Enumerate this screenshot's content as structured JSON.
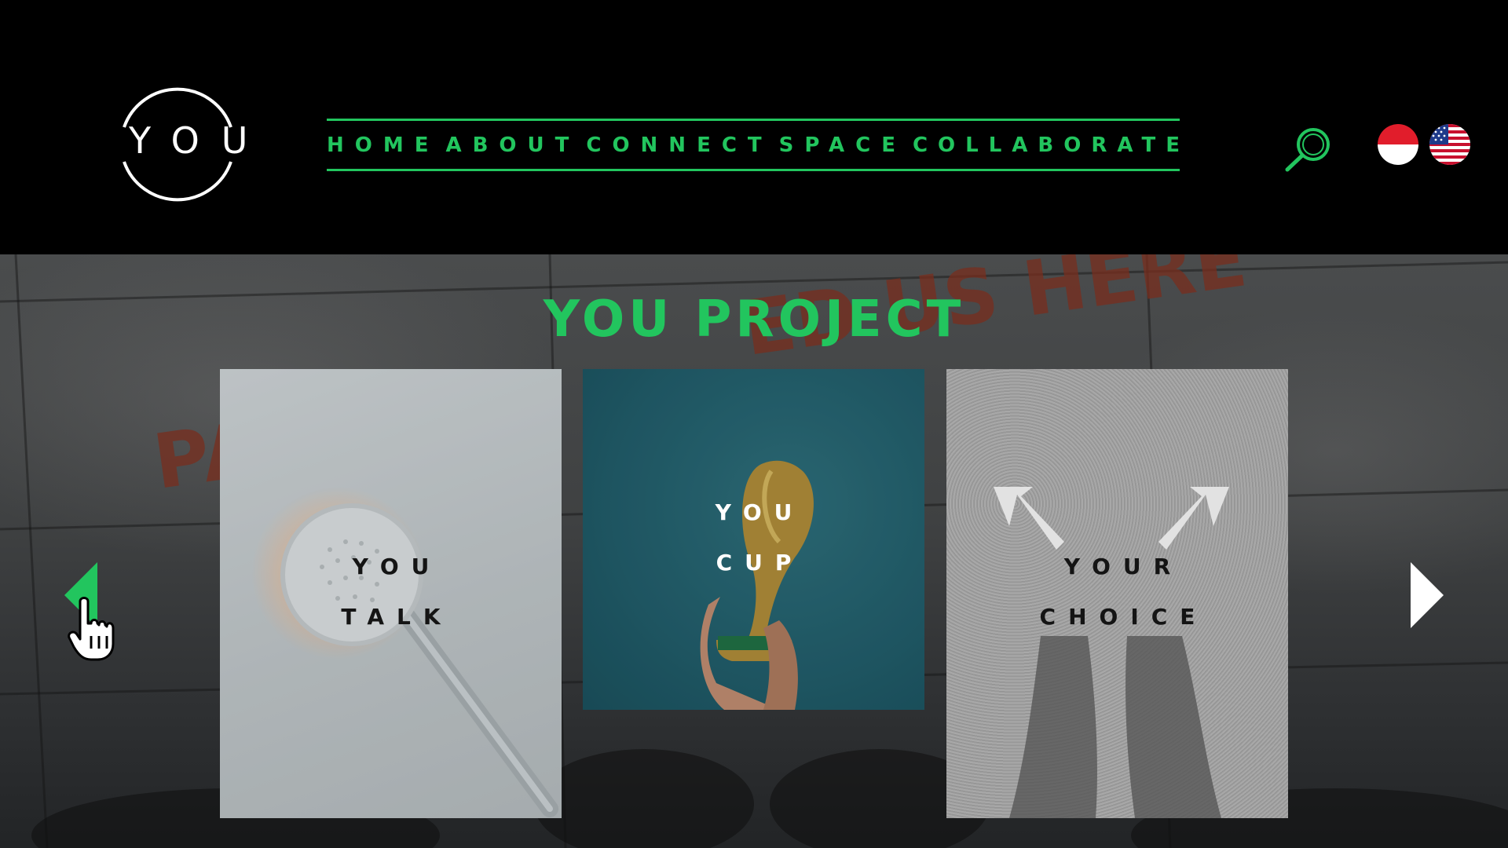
{
  "header": {
    "logo_text": "YOU",
    "nav": [
      {
        "label": "HOME"
      },
      {
        "label": "ABOUT"
      },
      {
        "label": "CONNECT"
      },
      {
        "label": "SPACE"
      },
      {
        "label": "COLLABORATE"
      }
    ],
    "search_icon": "search-icon",
    "languages": [
      {
        "name": "indonesia-flag-icon"
      },
      {
        "name": "us-flag-icon"
      }
    ]
  },
  "hero": {
    "title": "YOU PROJECT",
    "background_text": [
      "PA",
      "ED US HERE"
    ],
    "cards": [
      {
        "line1": "YOU",
        "line2": "TALK"
      },
      {
        "line1": "YOU",
        "line2": "CUP"
      },
      {
        "line1": "YOUR",
        "line2": "CHOICE"
      }
    ],
    "prev_icon": "arrow-left-icon",
    "next_icon": "arrow-right-icon"
  },
  "colors": {
    "accent": "#22c55e",
    "header_bg": "#000000",
    "text_light": "#ffffff"
  }
}
